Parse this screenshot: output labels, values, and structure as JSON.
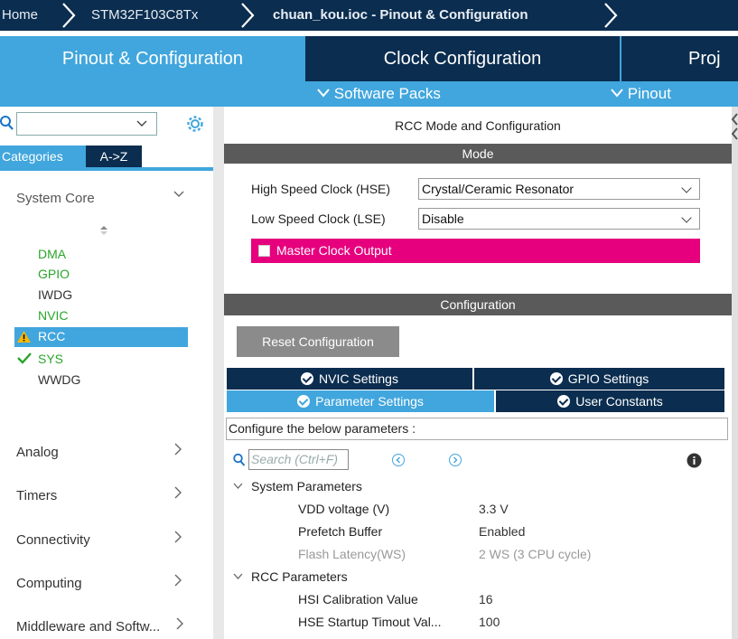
{
  "breadcrumb": {
    "items": [
      "Home",
      "STM32F103C8Tx",
      "chuan_kou.ioc - Pinout & Configuration"
    ]
  },
  "tabs": {
    "pinout": "Pinout & Configuration",
    "clock": "Clock Configuration",
    "project": "Proj"
  },
  "subbar": {
    "software_packs": "Software Packs",
    "pinout": "Pinout"
  },
  "sidebar": {
    "search_value": "",
    "tab_categories": "Categories",
    "tab_az": "A->Z",
    "system_core": "System Core",
    "system_core_items": [
      "DMA",
      "GPIO",
      "IWDG",
      "NVIC",
      "RCC",
      "SYS",
      "WWDG"
    ],
    "categories": [
      "Analog",
      "Timers",
      "Connectivity",
      "Computing",
      "Middleware and Softw..."
    ]
  },
  "main": {
    "title": "RCC Mode and Configuration",
    "mode_header": "Mode",
    "hse_label": "High Speed Clock (HSE)",
    "hse_value": "Crystal/Ceramic Resonator",
    "lse_label": "Low Speed Clock (LSE)",
    "lse_value": "Disable",
    "mco_label": "Master Clock Output",
    "config_header": "Configuration",
    "reset_button": "Reset Configuration",
    "subtabs": {
      "nvic": "NVIC Settings",
      "gpio": "GPIO Settings",
      "parameter": "Parameter Settings",
      "user_constants": "User Constants"
    },
    "configure_text": "Configure the below parameters :",
    "search_placeholder": "Search (Ctrl+F)",
    "groups": {
      "system": "System Parameters",
      "rcc": "RCC Parameters"
    },
    "system_params": [
      {
        "name": "VDD voltage (V)",
        "value": "3.3 V"
      },
      {
        "name": "Prefetch Buffer",
        "value": "Enabled"
      },
      {
        "name": "Flash Latency(WS)",
        "value": "2 WS (3 CPU cycle)"
      }
    ],
    "rcc_params": [
      {
        "name": "HSI Calibration Value",
        "value": "16"
      },
      {
        "name": "HSE Startup Timout Val...",
        "value": "100"
      }
    ]
  },
  "colors": {
    "dark_navy": "#0b2d4f",
    "accent_blue": "#41a6dd",
    "mco_magenta": "#e6007e",
    "ok_green": "#2aa52a",
    "warn_yellow": "#f5b800"
  }
}
